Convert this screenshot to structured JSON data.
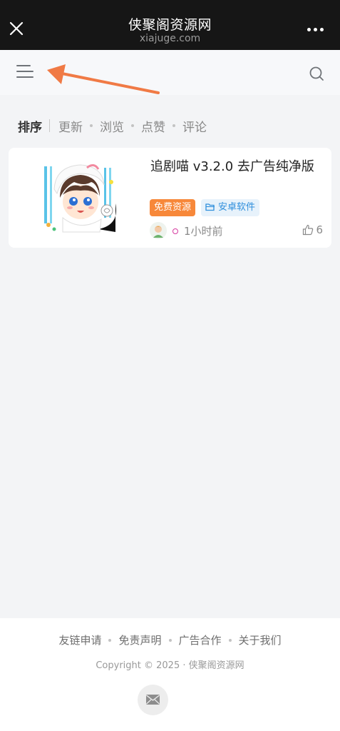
{
  "header": {
    "title": "侠聚阁资源网",
    "subtitle": "xiajuge.com"
  },
  "sort": {
    "label": "排序",
    "options": [
      "更新",
      "浏览",
      "点赞",
      "评论"
    ]
  },
  "posts": [
    {
      "title": "追剧喵 v3.2.0 去广告纯净版",
      "tags": [
        "免费资源",
        "安卓软件"
      ],
      "time": "1小时前",
      "likes": "6"
    }
  ],
  "footer": {
    "links": [
      "友链申请",
      "免责声明",
      "广告合作",
      "关于我们"
    ],
    "copyright": "Copyright © 2025 · 侠聚阁资源网"
  },
  "colors": {
    "topbar": "#161616",
    "accent_orange": "#f7883a",
    "tag_blue": "#2f8fdc",
    "annotation_arrow": "#f07a45"
  },
  "icons": {
    "close": "close-icon",
    "more": "more-icon",
    "menu": "hamburger-menu-icon",
    "search": "search-icon",
    "folder": "folder-icon",
    "like": "thumbs-up-icon",
    "mail": "mail-icon"
  }
}
